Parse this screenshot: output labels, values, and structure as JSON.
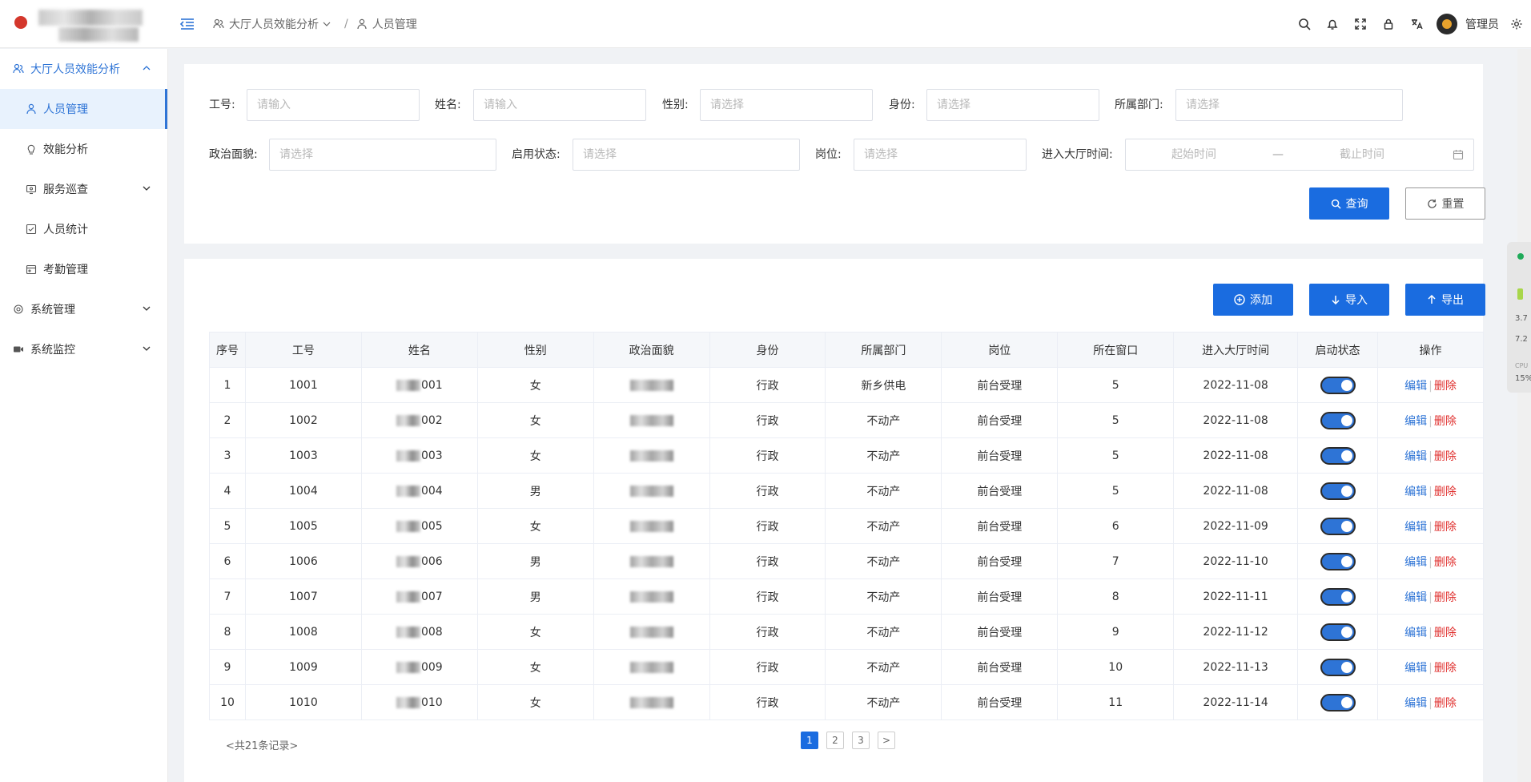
{
  "header": {
    "breadcrumb": [
      "大厅人员效能分析",
      "/",
      "人员管理"
    ],
    "user_name": "管理员"
  },
  "sidebar": {
    "items": [
      {
        "label": "大厅人员效能分析",
        "icon": "users-icon",
        "level": 1,
        "state": "open"
      },
      {
        "label": "人员管理",
        "icon": "user-icon",
        "level": 2,
        "state": "active"
      },
      {
        "label": "效能分析",
        "icon": "bulb-icon",
        "level": 2
      },
      {
        "label": "服务巡查",
        "icon": "monitor-icon",
        "level": 2,
        "expandable": true
      },
      {
        "label": "人员统计",
        "icon": "checkbox-icon",
        "level": 2
      },
      {
        "label": "考勤管理",
        "icon": "calendar-icon",
        "level": 2
      },
      {
        "label": "系统管理",
        "icon": "gear-icon",
        "level": 1,
        "expandable": true
      },
      {
        "label": "系统监控",
        "icon": "video-icon",
        "level": 1,
        "expandable": true
      }
    ]
  },
  "search": {
    "employee_id_label": "工号:",
    "employee_id_placeholder": "请输入",
    "name_label": "姓名:",
    "name_placeholder": "请输入",
    "gender_label": "性别:",
    "gender_placeholder": "请选择",
    "identity_label": "身份:",
    "identity_placeholder": "请选择",
    "department_label": "所属部门:",
    "department_placeholder": "请选择",
    "political_label": "政治面貌:",
    "political_placeholder": "请选择",
    "status_label": "启用状态:",
    "status_placeholder": "请选择",
    "position_label": "岗位:",
    "position_placeholder": "请选择",
    "enter_time_label": "进入大厅时间:",
    "start_placeholder": "起始时间",
    "range_sep": "—",
    "end_placeholder": "截止时间",
    "query_label": "查询",
    "reset_label": "重置"
  },
  "toolbar": {
    "add_label": "添加",
    "import_label": "导入",
    "export_label": "导出"
  },
  "table": {
    "headers": [
      "序号",
      "工号",
      "姓名",
      "性别",
      "政治面貌",
      "身份",
      "所属部门",
      "岗位",
      "所在窗口",
      "进入大厅时间",
      "启动状态",
      "操作"
    ],
    "rows": [
      {
        "no": "1",
        "id": "1001",
        "name_suffix": "001",
        "gender": "女",
        "identity": "行政",
        "dept": "新乡供电",
        "post": "前台受理",
        "window": "5",
        "date": "2022-11-08",
        "enabled": true
      },
      {
        "no": "2",
        "id": "1002",
        "name_suffix": "002",
        "gender": "女",
        "identity": "行政",
        "dept": "不动产",
        "post": "前台受理",
        "window": "5",
        "date": "2022-11-08",
        "enabled": true
      },
      {
        "no": "3",
        "id": "1003",
        "name_suffix": "003",
        "gender": "女",
        "identity": "行政",
        "dept": "不动产",
        "post": "前台受理",
        "window": "5",
        "date": "2022-11-08",
        "enabled": true
      },
      {
        "no": "4",
        "id": "1004",
        "name_suffix": "004",
        "gender": "男",
        "identity": "行政",
        "dept": "不动产",
        "post": "前台受理",
        "window": "5",
        "date": "2022-11-08",
        "enabled": true
      },
      {
        "no": "5",
        "id": "1005",
        "name_suffix": "005",
        "gender": "女",
        "identity": "行政",
        "dept": "不动产",
        "post": "前台受理",
        "window": "6",
        "date": "2022-11-09",
        "enabled": true
      },
      {
        "no": "6",
        "id": "1006",
        "name_suffix": "006",
        "gender": "男",
        "identity": "行政",
        "dept": "不动产",
        "post": "前台受理",
        "window": "7",
        "date": "2022-11-10",
        "enabled": true
      },
      {
        "no": "7",
        "id": "1007",
        "name_suffix": "007",
        "gender": "男",
        "identity": "行政",
        "dept": "不动产",
        "post": "前台受理",
        "window": "8",
        "date": "2022-11-11",
        "enabled": true
      },
      {
        "no": "8",
        "id": "1008",
        "name_suffix": "008",
        "gender": "女",
        "identity": "行政",
        "dept": "不动产",
        "post": "前台受理",
        "window": "9",
        "date": "2022-11-12",
        "enabled": true
      },
      {
        "no": "9",
        "id": "1009",
        "name_suffix": "009",
        "gender": "女",
        "identity": "行政",
        "dept": "不动产",
        "post": "前台受理",
        "window": "10",
        "date": "2022-11-13",
        "enabled": true
      },
      {
        "no": "10",
        "id": "1010",
        "name_suffix": "010",
        "gender": "女",
        "identity": "行政",
        "dept": "不动产",
        "post": "前台受理",
        "window": "11",
        "date": "2022-11-14",
        "enabled": true
      }
    ],
    "edit_label": "编辑",
    "op_sep": "|",
    "delete_label": "删除"
  },
  "pagination": {
    "total_text": "<共21条记录>",
    "pages": [
      "1",
      "2",
      "3"
    ],
    "current": "1",
    "next": ">"
  },
  "widget": {
    "up_value": "3.7",
    "down_value": "7.2",
    "cpu_label": "CPU",
    "cpu_value": "15%"
  },
  "colors": {
    "accent": "#1a6ce0",
    "active_bg": "#e8f2fd",
    "danger": "#e0312f"
  }
}
